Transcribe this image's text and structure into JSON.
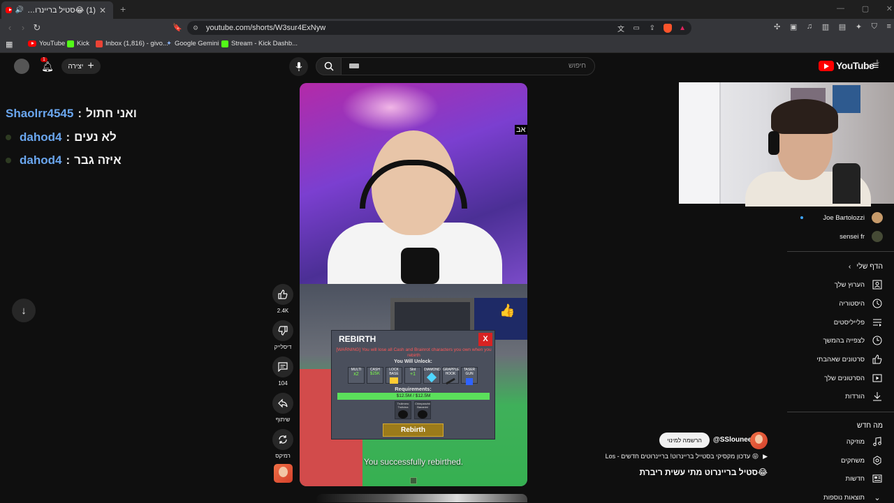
{
  "browser": {
    "tab_title": "(1) 😂סטיל בריינרוט מתי עשי",
    "new_tab": "+",
    "url": "youtube.com/shorts/W3sur4ExNyw",
    "bookmarks": [
      "YouTube",
      "Kick",
      "Inbox (1,816) - givo...",
      "Google Gemini",
      "Stream - Kick Dashb..."
    ]
  },
  "header": {
    "logo_text": "YouTube",
    "logo_region": "IL",
    "search_placeholder": "חיפוש",
    "create_label": "יצירה",
    "notif_count": "1"
  },
  "chat": [
    {
      "user": "Shaolrr4545",
      "sep": ":",
      "message": "ואני חתול"
    },
    {
      "user": "dahod4",
      "sep": ":",
      "message": "לא נעים"
    },
    {
      "user": "dahod4",
      "sep": ":",
      "message": "איזה גבר"
    }
  ],
  "video": {
    "corner_tag": "אב",
    "game": {
      "title": "REBIRTH",
      "close": "X",
      "warning": "[WARNING] You will lose all Cash and Brainrot characters you own when you rebirth",
      "unlock_label": "You Will Unlock:",
      "slots": [
        "MULTI",
        "CASH",
        "LOCK BASE",
        "Slot",
        "DIAMOND",
        "GRAPPLE HOOK",
        "TASER GUN"
      ],
      "slot_values": [
        "x2",
        "$25K",
        "",
        "+1",
        "",
        "",
        ""
      ],
      "requirements_label": "Requirements:",
      "req_progress": "$12.5M / $12.5M",
      "req_items": [
        "Trulimero Trulicina",
        "Chimpanzini Bananini"
      ],
      "button": "Rebirth",
      "toast": "You successfully rebirthed."
    }
  },
  "actions": {
    "likes": "2.4K",
    "dislike": "דיסלייק",
    "comments": "104",
    "share": "שיתוף",
    "remix": "רמיקס"
  },
  "sidebar": {
    "subscriptions": [
      "Joe Bartolozzi",
      "sensei fr"
    ],
    "you_header": "הדף שלי",
    "you_items": [
      "הערוץ שלך",
      "היסטוריה",
      "פלייליסטים",
      "לצפייה בהמשך",
      "סרטונים שאהבתי",
      "הסרטונים שלך",
      "הורדות"
    ],
    "explore_header": "מה חדש",
    "explore_items": [
      "מוזיקה",
      "משחקים",
      "חדשות",
      "תוצאות נוספות"
    ]
  },
  "shorts_info": {
    "channel": "@SSlounee",
    "subscribe": "הרשמה למינוי",
    "description": "😝 עדכון מקסיקי בסטייל בריינרוט! בריינרוטים חדשים - Los",
    "title": "😂סטיל בריינרוט מתי עשית ריברת"
  }
}
